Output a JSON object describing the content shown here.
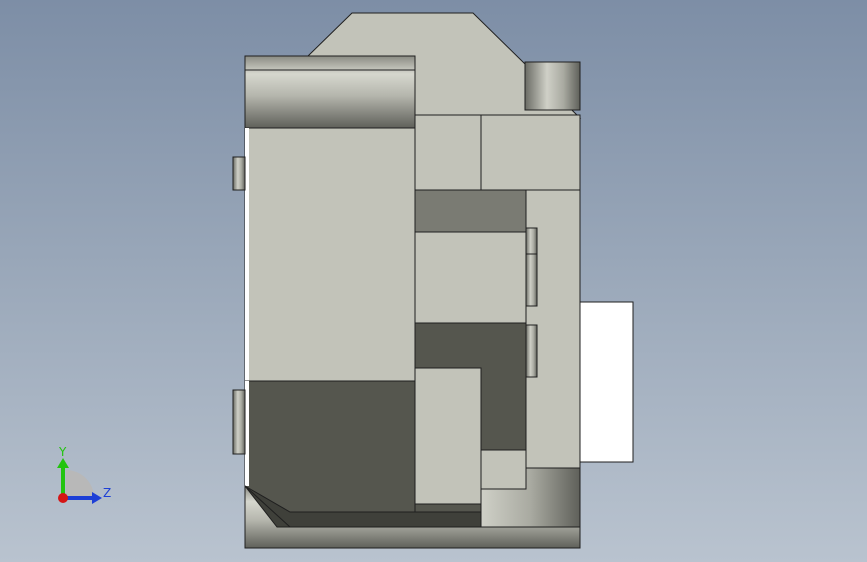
{
  "viewport": {
    "colors": {
      "background_top": "#7d8ea6",
      "background_bottom": "#b9c3cf",
      "part_light": "#c2c3b9",
      "part_mid": "#a7a89d",
      "part_dark": "#55564e",
      "part_darker": "#3f403a",
      "part_grey": "#7a7b73",
      "edge": "#1f1f1f",
      "white_face": "#ffffff"
    }
  },
  "triad": {
    "y_label": "Y",
    "z_label": "Z",
    "y_color": "#22c40f",
    "z_color": "#1d3fd6",
    "origin_color": "#d41515"
  }
}
